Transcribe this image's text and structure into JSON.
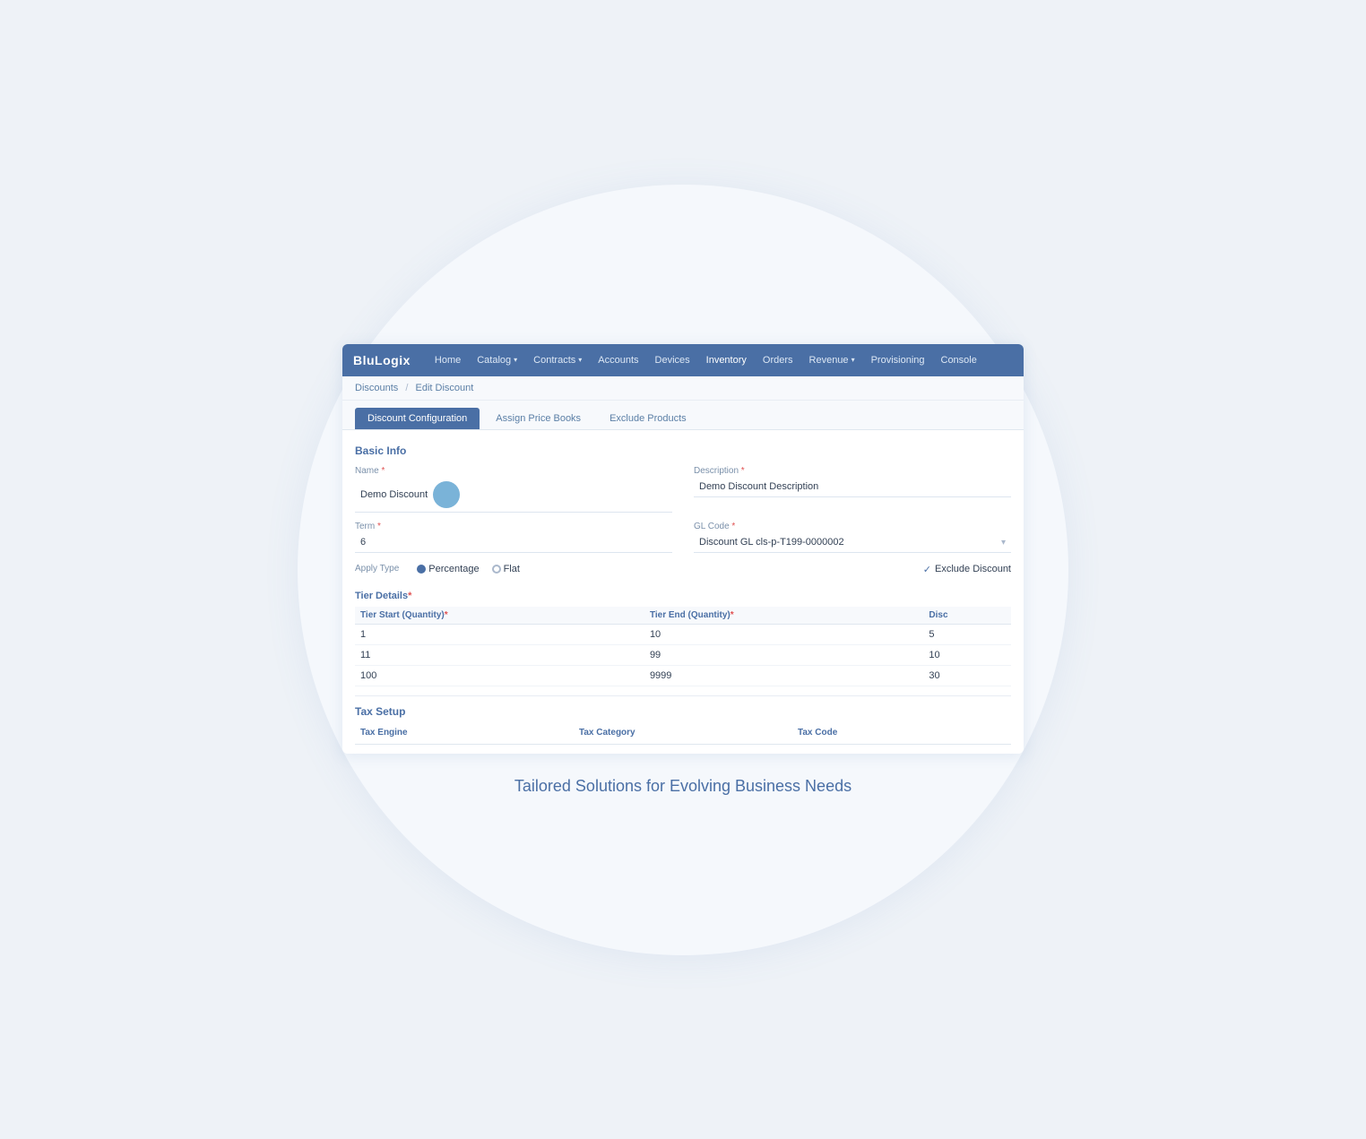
{
  "app": {
    "brand": "BluLogix",
    "brand_blu": "Blu",
    "brand_logix": "Logix"
  },
  "navbar": {
    "items": [
      {
        "label": "Home",
        "has_dropdown": false
      },
      {
        "label": "Catalog",
        "has_dropdown": true
      },
      {
        "label": "Contracts",
        "has_dropdown": true
      },
      {
        "label": "Accounts",
        "has_dropdown": false
      },
      {
        "label": "Devices",
        "has_dropdown": false
      },
      {
        "label": "Inventory",
        "has_dropdown": false
      },
      {
        "label": "Orders",
        "has_dropdown": false
      },
      {
        "label": "Revenue",
        "has_dropdown": true
      },
      {
        "label": "Provisioning",
        "has_dropdown": false
      },
      {
        "label": "Console",
        "has_dropdown": false
      }
    ]
  },
  "breadcrumb": {
    "parent": "Discounts",
    "current": "Edit Discount",
    "separator": "/"
  },
  "tabs": {
    "items": [
      {
        "label": "Discount Configuration",
        "active": true
      },
      {
        "label": "Assign Price Books",
        "active": false
      },
      {
        "label": "Exclude Products",
        "active": false
      }
    ]
  },
  "basic_info": {
    "title": "Basic Info",
    "name_label": "Name",
    "name_required": "*",
    "name_value": "Demo Discount",
    "description_label": "Description",
    "description_required": "*",
    "description_value": "Demo Discount Description",
    "term_label": "Term",
    "term_required": "*",
    "term_value": "6",
    "gl_code_label": "GL Code",
    "gl_code_required": "*",
    "gl_code_value": "Discount GL cls-p-T199-0000002",
    "apply_type_label": "Apply Type",
    "apply_type_percentage": "Percentage",
    "apply_type_flat": "Flat",
    "exclude_discount_label": "Exclude Discount",
    "exclude_checked": true
  },
  "tier_details": {
    "title": "Tier Details",
    "title_required": "*",
    "col_start": "Tier Start (Quantity)",
    "col_start_required": "*",
    "col_end": "Tier End (Quantity)",
    "col_end_required": "*",
    "col_discount": "Disc",
    "rows": [
      {
        "start": "1",
        "end": "10",
        "discount": "5"
      },
      {
        "start": "11",
        "end": "99",
        "discount": "10"
      },
      {
        "start": "100",
        "end": "9999",
        "discount": "30"
      }
    ]
  },
  "tax_setup": {
    "title": "Tax Setup",
    "col_engine": "Tax Engine",
    "col_category": "Tax Category",
    "col_code": "Tax Code"
  },
  "tagline": "Tailored Solutions for Evolving Business Needs"
}
